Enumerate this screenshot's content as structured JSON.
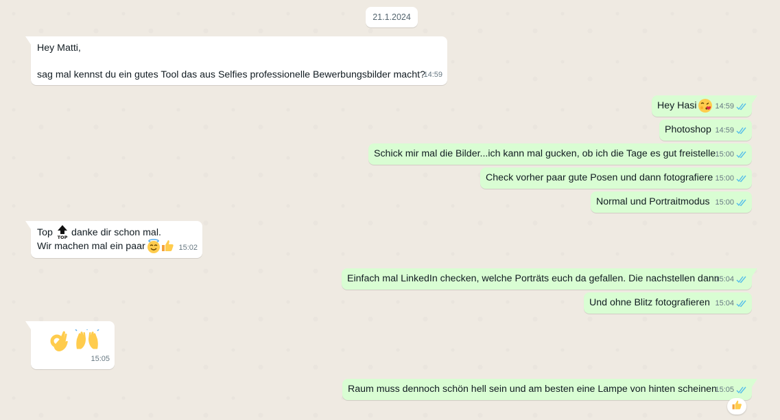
{
  "date_separator": "21.1.2024",
  "messages": [
    {
      "id": "m1",
      "dir": "in",
      "lines": [
        "Hey Matti,",
        "",
        "sag mal kennst du ein gutes Tool das aus Selfies professionelle Bewerbungsbilder macht?"
      ],
      "time": "14:59"
    },
    {
      "id": "m2",
      "dir": "out",
      "text": "Hey Hasi",
      "emoji": "face-blowing-kiss-icon",
      "time": "14:59",
      "status": "read"
    },
    {
      "id": "m3",
      "dir": "out",
      "text": "Photoshop",
      "time": "14:59",
      "status": "read"
    },
    {
      "id": "m4",
      "dir": "out",
      "text": "Schick mir mal die Bilder...ich kann mal gucken, ob ich die Tage es gut freistelle",
      "time": "15:00",
      "status": "read"
    },
    {
      "id": "m5",
      "dir": "out",
      "text": "Check vorher paar gute Posen und dann fotografiere",
      "time": "15:00",
      "status": "read"
    },
    {
      "id": "m6",
      "dir": "out",
      "text": "Normal und Portraitmodus",
      "time": "15:00",
      "status": "read"
    },
    {
      "id": "m7",
      "dir": "in",
      "line1_before": "Top",
      "line1_after": "danke dir schon mal.",
      "line2": "Wir machen mal ein paar",
      "emojis": [
        "top-arrow-icon",
        "smiling-face-with-halo-icon",
        "thumbs-up-icon"
      ],
      "time": "15:02"
    },
    {
      "id": "m8",
      "dir": "out",
      "text": "Einfach mal LinkedIn checken, welche Porträts euch da gefallen. Die nachstellen dann",
      "time": "15:04",
      "status": "read"
    },
    {
      "id": "m9",
      "dir": "out",
      "text": "Und ohne Blitz fotografieren",
      "time": "15:04",
      "status": "read"
    },
    {
      "id": "m10",
      "dir": "in",
      "emojis": [
        "ok-hand-icon",
        "raising-hands-icon"
      ],
      "time": "15:05"
    },
    {
      "id": "m11",
      "dir": "out",
      "text": "Raum muss dennoch schön hell sein und am besten eine Lampe von hinten scheinen",
      "time": "15:05",
      "status": "read",
      "reaction": "thumbs-up-icon"
    }
  ],
  "colors": {
    "background": "#efeae2",
    "incoming_bubble": "#ffffff",
    "outgoing_bubble": "#d9fdd3",
    "read_ticks": "#53bdeb",
    "meta_text": "#667781"
  }
}
